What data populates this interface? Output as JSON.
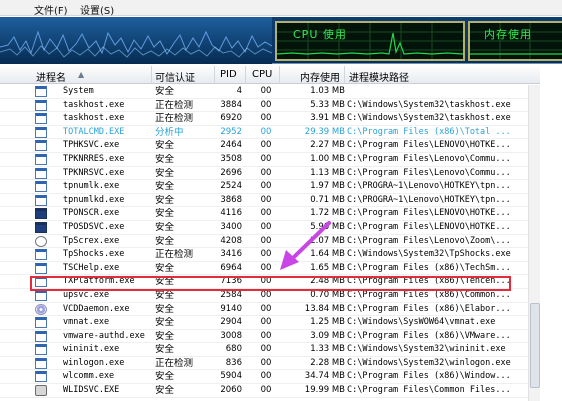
{
  "menu": {
    "file": "文件(F)",
    "settings": "设置(S)"
  },
  "monitor": {
    "cpu_title": "CPU 使用",
    "mem_title": "内存使用"
  },
  "columns": {
    "name": "进程名",
    "trust": "可信认证",
    "pid": "PID",
    "cpu": "CPU",
    "mem": "内存使用",
    "path": "进程模块路径"
  },
  "rows": [
    {
      "name": "System",
      "trust": "安全",
      "pid": "4",
      "cpu": "00",
      "mem": "1.03 MB",
      "path": "",
      "icon": "window",
      "state": "normal"
    },
    {
      "name": "taskhost.exe",
      "trust": "正在检测",
      "pid": "3884",
      "cpu": "00",
      "mem": "5.33 MB",
      "path": "C:\\Windows\\System32\\taskhost.exe",
      "icon": "window",
      "state": "normal"
    },
    {
      "name": "taskhost.exe",
      "trust": "正在检测",
      "pid": "6920",
      "cpu": "00",
      "mem": "3.91 MB",
      "path": "C:\\Windows\\System32\\taskhost.exe",
      "icon": "window",
      "state": "normal"
    },
    {
      "name": "TOTALCMD.EXE",
      "trust": "分析中",
      "pid": "2952",
      "cpu": "00",
      "mem": "29.39 MB",
      "path": "C:\\Program Files (x86)\\Total ...",
      "icon": "window",
      "state": "analyzing"
    },
    {
      "name": "TPHKSVC.exe",
      "trust": "安全",
      "pid": "2464",
      "cpu": "00",
      "mem": "2.27 MB",
      "path": "C:\\Program Files\\LENOVO\\HOTKE...",
      "icon": "window",
      "state": "normal"
    },
    {
      "name": "TPKNRRES.exe",
      "trust": "安全",
      "pid": "3508",
      "cpu": "00",
      "mem": "1.00 MB",
      "path": "C:\\Program Files\\Lenovo\\Commu...",
      "icon": "window",
      "state": "normal"
    },
    {
      "name": "TPKNRSVC.exe",
      "trust": "安全",
      "pid": "2696",
      "cpu": "00",
      "mem": "1.13 MB",
      "path": "C:\\Program Files\\Lenovo\\Commu...",
      "icon": "window",
      "state": "normal"
    },
    {
      "name": "tpnumlk.exe",
      "trust": "安全",
      "pid": "2524",
      "cpu": "00",
      "mem": "1.97 MB",
      "path": "C:\\PROGRA~1\\Lenovo\\HOTKEY\\tpn...",
      "icon": "window",
      "state": "normal"
    },
    {
      "name": "tpnumlkd.exe",
      "trust": "安全",
      "pid": "3868",
      "cpu": "00",
      "mem": "0.71 MB",
      "path": "C:\\PROGRA~1\\Lenovo\\HOTKEY\\tpn...",
      "icon": "window",
      "state": "normal"
    },
    {
      "name": "TPONSCR.exe",
      "trust": "安全",
      "pid": "4116",
      "cpu": "00",
      "mem": "1.72 MB",
      "path": "C:\\Program Files\\LENOVO\\HOTKE...",
      "icon": "dark",
      "state": "normal"
    },
    {
      "name": "TPOSDSVC.exe",
      "trust": "安全",
      "pid": "3400",
      "cpu": "00",
      "mem": "5.96 MB",
      "path": "C:\\Program Files\\LENOVO\\HOTKE...",
      "icon": "dark",
      "state": "normal"
    },
    {
      "name": "TpScrex.exe",
      "trust": "安全",
      "pid": "4208",
      "cpu": "00",
      "mem": "2.07 MB",
      "path": "C:\\Program Files\\Lenovo\\Zoom\\...",
      "icon": "mag",
      "state": "normal"
    },
    {
      "name": "TpShocks.exe",
      "trust": "正在检测",
      "pid": "3416",
      "cpu": "00",
      "mem": "1.64 MB",
      "path": "C:\\Windows\\System32\\TpShocks.exe",
      "icon": "window",
      "state": "normal"
    },
    {
      "name": "TSCHelp.exe",
      "trust": "安全",
      "pid": "6964",
      "cpu": "00",
      "mem": "1.65 MB",
      "path": "C:\\Program Files (x86)\\TechSm...",
      "icon": "window",
      "state": "normal"
    },
    {
      "name": "TXPlatform.exe",
      "trust": "安全",
      "pid": "7136",
      "cpu": "00",
      "mem": "2.48 MB",
      "path": "C:\\Program Files (x86)\\Tencen...",
      "icon": "window",
      "state": "highlight"
    },
    {
      "name": "upsvc.exe",
      "trust": "安全",
      "pid": "2584",
      "cpu": "00",
      "mem": "0.70 MB",
      "path": "C:\\Program Files (x86)\\Common...",
      "icon": "window",
      "state": "normal"
    },
    {
      "name": "VCDDaemon.exe",
      "trust": "安全",
      "pid": "9140",
      "cpu": "00",
      "mem": "13.84 MB",
      "path": "C:\\Program Files (x86)\\Elabor...",
      "icon": "cd",
      "state": "normal"
    },
    {
      "name": "vmnat.exe",
      "trust": "安全",
      "pid": "2904",
      "cpu": "00",
      "mem": "1.25 MB",
      "path": "C:\\Windows\\SysWOW64\\vmnat.exe",
      "icon": "window",
      "state": "normal"
    },
    {
      "name": "vmware-authd.exe",
      "trust": "安全",
      "pid": "3008",
      "cpu": "00",
      "mem": "3.09 MB",
      "path": "C:\\Program Files (x86)\\VMware...",
      "icon": "window",
      "state": "normal"
    },
    {
      "name": "wininit.exe",
      "trust": "安全",
      "pid": "680",
      "cpu": "00",
      "mem": "1.33 MB",
      "path": "C:\\Windows\\System32\\wininit.exe",
      "icon": "window",
      "state": "normal"
    },
    {
      "name": "winlogon.exe",
      "trust": "正在检测",
      "pid": "836",
      "cpu": "00",
      "mem": "2.28 MB",
      "path": "C:\\Windows\\System32\\winlogon.exe",
      "icon": "window",
      "state": "normal"
    },
    {
      "name": "wlcomm.exe",
      "trust": "安全",
      "pid": "5904",
      "cpu": "00",
      "mem": "34.74 MB",
      "path": "C:\\Program Files (x86)\\Window...",
      "icon": "window",
      "state": "normal"
    },
    {
      "name": "WLIDSVC.EXE",
      "trust": "安全",
      "pid": "2060",
      "cpu": "00",
      "mem": "19.99 MB",
      "path": "C:\\Program Files\\Common Files...",
      "icon": "gear",
      "state": "normal"
    }
  ],
  "colors": {
    "analyzing": "#29a3d8",
    "highlight_box": "#e32b39",
    "arrow": "#c945e6",
    "graph_line": "#25d64b"
  }
}
